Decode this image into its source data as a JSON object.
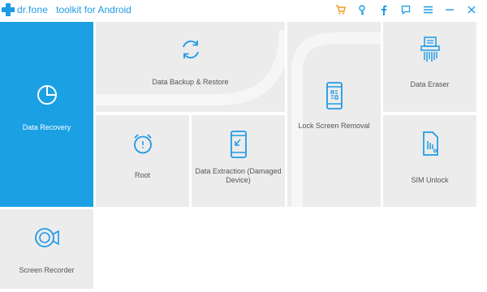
{
  "header": {
    "brand": "dr.fone",
    "tagline": "toolkit for Android",
    "icons": [
      "cart-icon",
      "key-icon",
      "facebook-icon",
      "feedback-icon",
      "menu-icon",
      "minimize-icon",
      "close-icon"
    ]
  },
  "colors": {
    "accent": "#1ba0e3",
    "tile_bg": "#ececec",
    "icon_blue": "#1e9be6",
    "label_gray": "#555555"
  },
  "tiles": {
    "data_recovery": {
      "label": "Data Recovery",
      "icon": "pie-chart-icon",
      "selected": true
    },
    "data_backup": {
      "label": "Data Backup & Restore",
      "icon": "sync-icon"
    },
    "lock_screen": {
      "label": "Lock Screen Removal",
      "icon": "phone-lock-icon"
    },
    "data_eraser": {
      "label": "Data Eraser",
      "icon": "shredder-icon"
    },
    "root": {
      "label": "Root",
      "icon": "root-clock-icon"
    },
    "data_extraction": {
      "label": "Data Extraction (Damaged Device)",
      "icon": "broken-phone-icon"
    },
    "sim_unlock": {
      "label": "SIM Unlock",
      "icon": "sim-card-icon"
    },
    "screen_recorder": {
      "label": "Screen Recorder",
      "icon": "camera-icon"
    }
  }
}
